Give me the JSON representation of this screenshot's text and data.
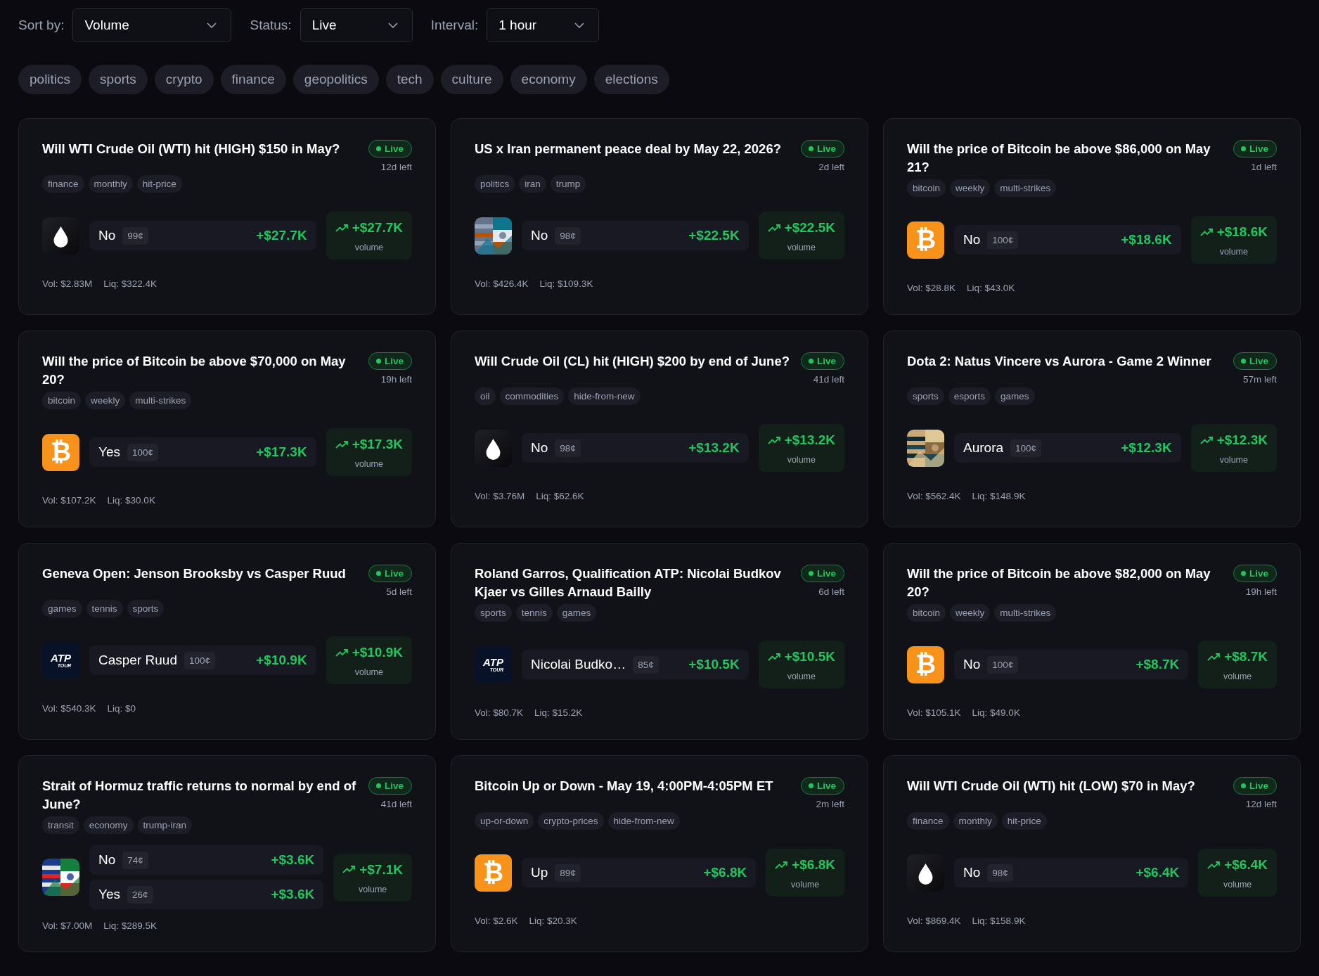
{
  "filters": [
    {
      "label": "Sort by:",
      "value": "Volume"
    },
    {
      "label": "Status:",
      "value": "Live"
    },
    {
      "label": "Interval:",
      "value": "1 hour"
    }
  ],
  "categories": [
    "politics",
    "sports",
    "crypto",
    "finance",
    "geopolitics",
    "tech",
    "culture",
    "economy",
    "elections"
  ],
  "markets": [
    {
      "title": "Will WTI Crude Oil (WTI) hit (HIGH) $150 in May?",
      "status": "Live",
      "time_left": "12d left",
      "tags": [
        "finance",
        "monthly",
        "hit-price"
      ],
      "icon": {
        "kind": "drop"
      },
      "outcomes": [
        {
          "name": "No",
          "price": "99¢",
          "amount": "+$27.7K"
        }
      ],
      "volume_change": "+$27.7K",
      "volume_label": "volume",
      "vol": "Vol: $2.83M",
      "liq": "Liq: $322.4K"
    },
    {
      "title": "US x Iran permanent peace deal by May 22, 2026?",
      "status": "Live",
      "time_left": "2d left",
      "tags": [
        "politics",
        "iran",
        "trump"
      ],
      "icon": {
        "kind": "picture"
      },
      "outcomes": [
        {
          "name": "No",
          "price": "98¢",
          "amount": "+$22.5K"
        }
      ],
      "volume_change": "+$22.5K",
      "volume_label": "volume",
      "vol": "Vol: $426.4K",
      "liq": "Liq: $109.3K"
    },
    {
      "title": "Will the price of Bitcoin be above $86,000 on May 21?",
      "status": "Live",
      "time_left": "1d left",
      "tags": [
        "bitcoin",
        "weekly",
        "multi-strikes"
      ],
      "icon": {
        "kind": "coin",
        "glyph": "₿"
      },
      "outcomes": [
        {
          "name": "No",
          "price": "100¢",
          "amount": "+$18.6K"
        }
      ],
      "volume_change": "+$18.6K",
      "volume_label": "volume",
      "vol": "Vol: $28.8K",
      "liq": "Liq: $43.0K"
    },
    {
      "title": "Will the price of Bitcoin be above $70,000 on May 20?",
      "status": "Live",
      "time_left": "19h left",
      "tags": [
        "bitcoin",
        "weekly",
        "multi-strikes"
      ],
      "icon": {
        "kind": "coin",
        "glyph": "₿"
      },
      "outcomes": [
        {
          "name": "Yes",
          "price": "100¢",
          "amount": "+$17.3K"
        }
      ],
      "volume_change": "+$17.3K",
      "volume_label": "volume",
      "vol": "Vol: $107.2K",
      "liq": "Liq: $30.0K"
    },
    {
      "title": "Will Crude Oil (CL) hit (HIGH) $200 by end of June?",
      "status": "Live",
      "time_left": "41d left",
      "tags": [
        "oil",
        "commodities",
        "hide-from-new"
      ],
      "icon": {
        "kind": "drop"
      },
      "outcomes": [
        {
          "name": "No",
          "price": "98¢",
          "amount": "+$13.2K"
        }
      ],
      "volume_change": "+$13.2K",
      "volume_label": "volume",
      "vol": "Vol: $3.76M",
      "liq": "Liq: $62.6K"
    },
    {
      "title": "Dota 2: Natus Vincere vs Aurora - Game 2 Winner",
      "status": "Live",
      "time_left": "57m left",
      "tags": [
        "sports",
        "esports",
        "games"
      ],
      "icon": {
        "kind": "picture"
      },
      "outcomes": [
        {
          "name": "Aurora",
          "price": "100¢",
          "amount": "+$12.3K"
        }
      ],
      "volume_change": "+$12.3K",
      "volume_label": "volume",
      "vol": "Vol: $562.4K",
      "liq": "Liq: $148.9K"
    },
    {
      "title": "Geneva Open: Jenson Brooksby vs Casper Ruud",
      "status": "Live",
      "time_left": "5d left",
      "tags": [
        "games",
        "tennis",
        "sports"
      ],
      "icon": {
        "kind": "logo",
        "logo_top": "ATP",
        "logo_bottom": "TOUR"
      },
      "outcomes": [
        {
          "name": "Casper Ruud",
          "price": "100¢",
          "amount": "+$10.9K"
        }
      ],
      "volume_change": "+$10.9K",
      "volume_label": "volume",
      "vol": "Vol: $540.3K",
      "liq": "Liq: $0"
    },
    {
      "title": "Roland Garros, Qualification ATP: Nicolai Budkov Kjaer vs Gilles Arnaud Bailly",
      "status": "Live",
      "time_left": "6d left",
      "tags": [
        "sports",
        "tennis",
        "games"
      ],
      "icon": {
        "kind": "logo",
        "logo_top": "ATP",
        "logo_bottom": "TOUR"
      },
      "outcomes": [
        {
          "name": "Nicolai Budko…",
          "price": "85¢",
          "amount": "+$10.5K"
        }
      ],
      "volume_change": "+$10.5K",
      "volume_label": "volume",
      "vol": "Vol: $80.7K",
      "liq": "Liq: $15.2K"
    },
    {
      "title": "Will the price of Bitcoin be above $82,000 on May 20?",
      "status": "Live",
      "time_left": "19h left",
      "tags": [
        "bitcoin",
        "weekly",
        "multi-strikes"
      ],
      "icon": {
        "kind": "coin",
        "glyph": "₿"
      },
      "outcomes": [
        {
          "name": "No",
          "price": "100¢",
          "amount": "+$8.7K"
        }
      ],
      "volume_change": "+$8.7K",
      "volume_label": "volume",
      "vol": "Vol: $105.1K",
      "liq": "Liq: $49.0K"
    },
    {
      "title": "Strait of Hormuz traffic returns to normal by end of June?",
      "status": "Live",
      "time_left": "41d left",
      "tags": [
        "transit",
        "economy",
        "trump-iran"
      ],
      "icon": {
        "kind": "picture"
      },
      "outcomes": [
        {
          "name": "No",
          "price": "74¢",
          "amount": "+$3.6K"
        },
        {
          "name": "Yes",
          "price": "26¢",
          "amount": "+$3.6K"
        }
      ],
      "volume_change": "+$7.1K",
      "volume_label": "volume",
      "vol": "Vol: $7.00M",
      "liq": "Liq: $289.5K"
    },
    {
      "title": "Bitcoin Up or Down - May 19, 4:00PM-4:05PM ET",
      "status": "Live",
      "time_left": "2m left",
      "tags": [
        "up-or-down",
        "crypto-prices",
        "hide-from-new"
      ],
      "icon": {
        "kind": "coin",
        "glyph": "₿"
      },
      "outcomes": [
        {
          "name": "Up",
          "price": "89¢",
          "amount": "+$6.8K"
        }
      ],
      "volume_change": "+$6.8K",
      "volume_label": "volume",
      "vol": "Vol: $2.6K",
      "liq": "Liq: $20.3K"
    },
    {
      "title": "Will WTI Crude Oil (WTI) hit (LOW) $70 in May?",
      "status": "Live",
      "time_left": "12d left",
      "tags": [
        "finance",
        "monthly",
        "hit-price"
      ],
      "icon": {
        "kind": "drop"
      },
      "outcomes": [
        {
          "name": "No",
          "price": "98¢",
          "amount": "+$6.4K"
        }
      ],
      "volume_change": "+$6.4K",
      "volume_label": "volume",
      "vol": "Vol: $869.4K",
      "liq": "Liq: $158.9K"
    }
  ]
}
